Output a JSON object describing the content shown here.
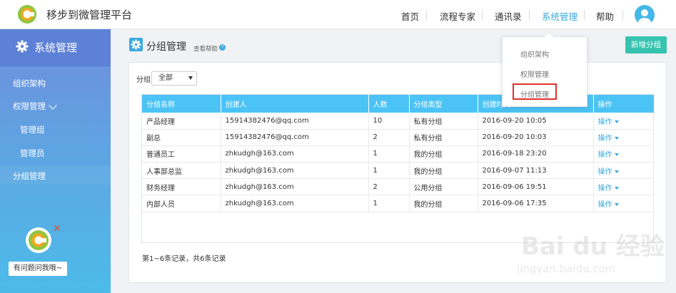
{
  "app": {
    "title": "移步到微管理平台"
  },
  "nav": {
    "items": [
      {
        "label": "首页"
      },
      {
        "label": "流程专家"
      },
      {
        "label": "通讯录"
      },
      {
        "label": "系统管理"
      },
      {
        "label": "帮助"
      }
    ],
    "active": "系统管理"
  },
  "dropdown": {
    "items": [
      {
        "label": "组织架构"
      },
      {
        "label": "权限管理"
      },
      {
        "label": "分组管理"
      }
    ],
    "highlighted": "分组管理"
  },
  "sidebar": {
    "title": "系统管理",
    "items": [
      {
        "label": "组织架构"
      },
      {
        "label": "权限管理"
      },
      {
        "label": "管理组"
      },
      {
        "label": "管理员"
      },
      {
        "label": "分组管理"
      }
    ],
    "help_button": "有问题问我哦~"
  },
  "page": {
    "title": "分组管理",
    "help_link": "查看帮助",
    "help_q": "?",
    "add_button": "新增分组",
    "filter_label": "分组",
    "filter_value": "全部"
  },
  "table": {
    "headers": [
      "分组名称",
      "创建人",
      "人数",
      "分组类型",
      "创建时间",
      "操作"
    ],
    "rows": [
      [
        "产品经理",
        "15914382476@qq.com",
        "10",
        "私有分组",
        "2016-09-20 10:05",
        "操作"
      ],
      [
        "副总",
        "15914382476@qq.com",
        "2",
        "私有分组",
        "2016-09-20 10:03",
        "操作"
      ],
      [
        "普通员工",
        "zhkudgh@163.com",
        "1",
        "我的分组",
        "2016-09-18 23:20",
        "操作"
      ],
      [
        "人事部总监",
        "zhkudgh@163.com",
        "1",
        "我的分组",
        "2016-09-07 11:13",
        "操作"
      ],
      [
        "财务经理",
        "zhkudgh@163.com",
        "2",
        "公用分组",
        "2016-09-06 19:51",
        "操作"
      ],
      [
        "内部人员",
        "zhkudgh@163.com",
        "1",
        "我的分组",
        "2016-09-06 17:35",
        "操作"
      ]
    ]
  },
  "pagination": {
    "text": "第1~6条记录，共6条记录"
  },
  "watermark": {
    "line1": "Bai du 经验",
    "line2": "jingyan.baidu.com"
  },
  "colors": {
    "accent": "#3aa9dd",
    "table_header": "#4cc3f5",
    "add_button": "#36c3b0",
    "highlight_border": "#e0322a",
    "sidebar_top": "#6f8ddd",
    "sidebar_bottom": "#4cbbe8"
  }
}
